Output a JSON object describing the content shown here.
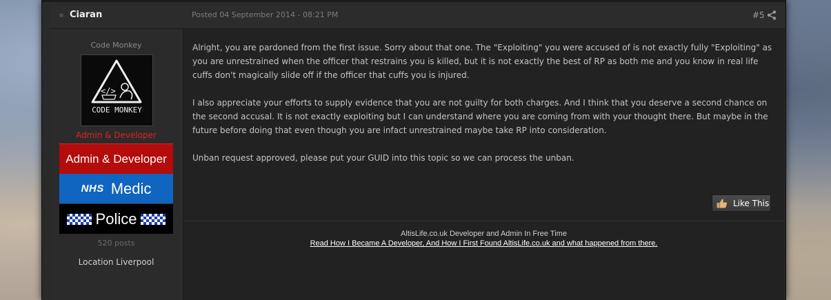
{
  "post": {
    "author": "Ciaran",
    "date": "Posted 04 September 2014 - 08:21 PM",
    "number": "#5",
    "share_icon": "share-icon",
    "author_panel": {
      "title": "Code Monkey",
      "avatar_text": "CODE MONKEY",
      "group": "Admin & Developer",
      "badges": {
        "admin": "Admin & Developer",
        "medic_prefix": "NHS",
        "medic": "Medic",
        "police": "Police"
      },
      "post_count": "520 posts",
      "location": "Location Liverpool"
    },
    "body": [
      "Alright, you are pardoned from the first issue. Sorry about that one. The \"Exploiting\" you were accused of is not exactly fully \"Exploiting\" as you are unrestrained when the officer that restrains you is killed, but it is not exactly the best of RP as both me and you know in real life cuffs don't magically slide off if the officer that cuffs you is injured.",
      "I also appreciate your efforts to supply evidence that you are not guilty for both charges. And I think that you deserve a second chance on the second accusal. It is not exactly exploiting but I can understand where you are coming from with your thought there. But maybe in the future before doing that even though you are infact unrestrained maybe take RP into consideration.",
      "Unban request approved, please put your GUID into this topic so we can process the unban."
    ],
    "like_button": "Like This",
    "signature": {
      "line1": "AltisLife.co.uk Developer and Admin In Free Time",
      "link": "Read How I Became A Developer, And How I First Found AltisLife.co.uk and what happened from there."
    }
  },
  "colors": {
    "group_red": "#e02020",
    "admin_badge": "#b40b0b",
    "medic_badge": "#0f65c0",
    "police_checker": "#1e3fa8"
  }
}
